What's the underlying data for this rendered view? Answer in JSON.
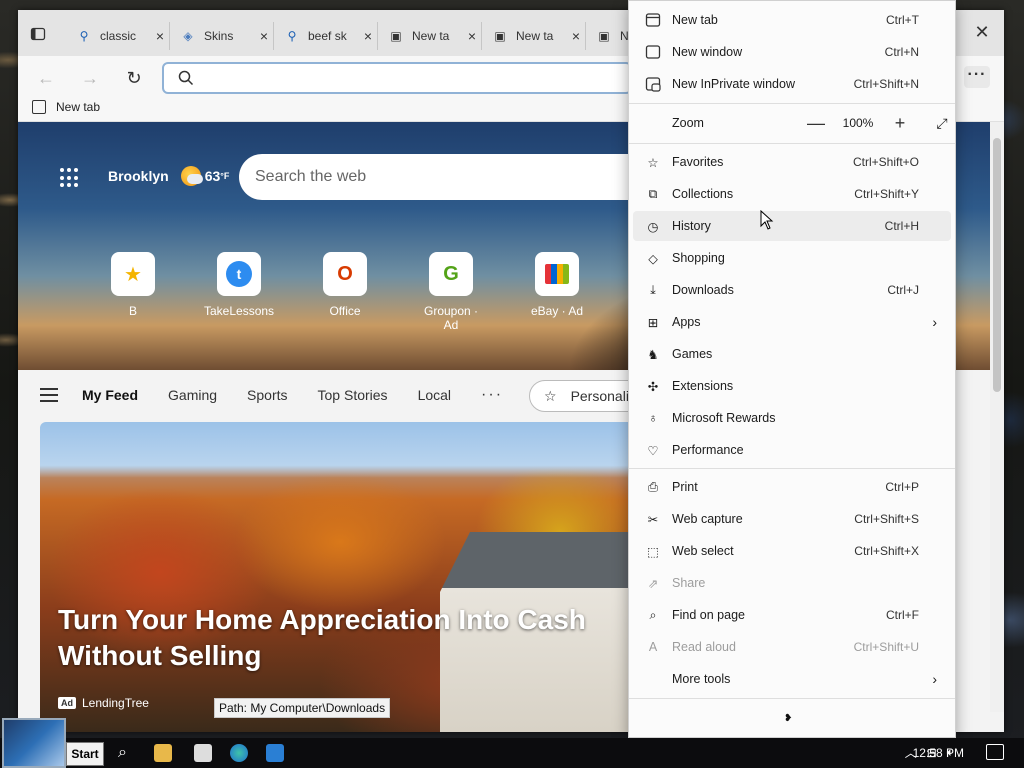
{
  "tabs": [
    {
      "label": "classic",
      "icon": "search-icon"
    },
    {
      "label": "Skins",
      "icon": "skin-icon"
    },
    {
      "label": "beef sk",
      "icon": "search-icon"
    },
    {
      "label": "New ta",
      "icon": "newtab-icon"
    },
    {
      "label": "New ta",
      "icon": "newtab-icon"
    },
    {
      "label": "N",
      "icon": "newtab-icon"
    }
  ],
  "toolbar": {
    "address_value": "",
    "more_label": "···"
  },
  "favorites": [
    {
      "label": "New tab"
    }
  ],
  "ntp": {
    "location": "Brooklyn",
    "temperature": "63",
    "unit": "°F",
    "search_placeholder": "Search the web",
    "tiles": [
      {
        "label": "B",
        "color": "#f4b400"
      },
      {
        "label": "TakeLessons",
        "color": "#2d8cf0"
      },
      {
        "label": "Office",
        "color": "#d83b01"
      },
      {
        "label": "Groupon · Ad",
        "color": "#53a318"
      },
      {
        "label": "eBay · Ad",
        "color": "#0064d2"
      }
    ],
    "feed_tabs": [
      "My Feed",
      "Gaming",
      "Sports",
      "Top Stories",
      "Local"
    ],
    "feed_more": "···",
    "personalize": "Personali",
    "card": {
      "title": "Turn Your Home Appreciation Into Cash Without Selling",
      "ad_badge": "Ad",
      "source": "LendingTree"
    }
  },
  "status_path": "Path: My Computer\\Downloads",
  "menu": {
    "zoom_label": "Zoom",
    "zoom_value": "100%",
    "zoom_minus": "—",
    "zoom_plus": "+",
    "more_arrow": "❥",
    "items": [
      {
        "label": "New tab",
        "shortcut": "Ctrl+T"
      },
      {
        "label": "New window",
        "shortcut": "Ctrl+N"
      },
      {
        "label": "New InPrivate window",
        "shortcut": "Ctrl+Shift+N"
      },
      {
        "label": "Favorites",
        "shortcut": "Ctrl+Shift+O"
      },
      {
        "label": "Collections",
        "shortcut": "Ctrl+Shift+Y"
      },
      {
        "label": "History",
        "shortcut": "Ctrl+H"
      },
      {
        "label": "Shopping",
        "shortcut": ""
      },
      {
        "label": "Downloads",
        "shortcut": "Ctrl+J"
      },
      {
        "label": "Apps",
        "shortcut": ""
      },
      {
        "label": "Games",
        "shortcut": ""
      },
      {
        "label": "Extensions",
        "shortcut": ""
      },
      {
        "label": "Microsoft Rewards",
        "shortcut": ""
      },
      {
        "label": "Performance",
        "shortcut": ""
      },
      {
        "label": "Print",
        "shortcut": "Ctrl+P"
      },
      {
        "label": "Web capture",
        "shortcut": "Ctrl+Shift+S"
      },
      {
        "label": "Web select",
        "shortcut": "Ctrl+Shift+X"
      },
      {
        "label": "Share",
        "shortcut": ""
      },
      {
        "label": "Find on page",
        "shortcut": "Ctrl+F"
      },
      {
        "label": "Read aloud",
        "shortcut": "Ctrl+Shift+U"
      },
      {
        "label": "More tools",
        "shortcut": ""
      }
    ]
  },
  "taskbar": {
    "start_label": "Start",
    "clock": "12:58 PM"
  }
}
